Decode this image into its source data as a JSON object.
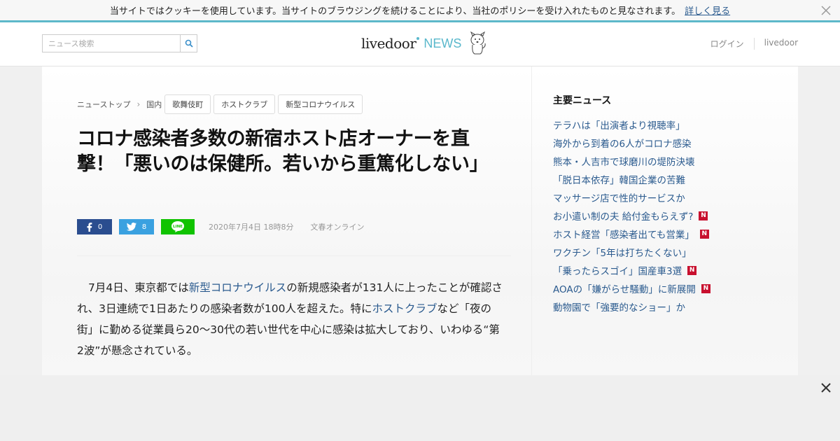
{
  "cookie": {
    "message": "当サイトではクッキーを使用しています。当サイトのブラウジングを続けることにより、当社のポリシーを受け入れたものと見なされます。",
    "more_link": "詳しく見る"
  },
  "header": {
    "search_placeholder": "ニュース検索",
    "logo_livedoor": "livedoor",
    "logo_news": "NEWS",
    "links": [
      "ログイン",
      "livedoor"
    ]
  },
  "breadcrumb": [
    "ニューストップ",
    "国内"
  ],
  "tags": [
    "歌舞伎町",
    "ホストクラブ",
    "新型コロナウイルス"
  ],
  "article": {
    "title": "コロナ感染者多数の新宿ホスト店オーナーを直撃！「悪いのは保健所。若いから重篤化しない」",
    "share": {
      "facebook_count": "0",
      "twitter_count": "8"
    },
    "date": "2020年7月4日 18時8分",
    "source": "文春オンライン",
    "body": {
      "p1": "7月4日、東京都では",
      "link1": "新型コロナウイルス",
      "p2": "の新規感染者が131人に上ったことが確認され、3日連続で1日あたりの感染者数が100人を超えた。特に",
      "link2": "ホストクラブ",
      "p3": "など「夜の街」に勤める従業員ら20～30代の若い世代を中心に感染は拡大しており、いわゆる“第2波”が懸念されている。"
    }
  },
  "sidebar": {
    "heading": "主要ニュース",
    "items": [
      {
        "label": "テラハは「出演者より視聴率」",
        "badge": ""
      },
      {
        "label": "海外から到着の6人がコロナ感染",
        "badge": ""
      },
      {
        "label": "熊本・人吉市で球磨川の堤防決壊",
        "badge": ""
      },
      {
        "label": "「脱日本依存」韓国企業の苦難",
        "badge": ""
      },
      {
        "label": "マッサージ店で性的サービスか",
        "badge": ""
      },
      {
        "label": "お小遣い制の夫 給付金もらえず?",
        "badge": "N"
      },
      {
        "label": "ホスト経営「感染者出ても営業」",
        "badge": "N"
      },
      {
        "label": "ワクチン「5年は打ちたくない」",
        "badge": ""
      },
      {
        "label": "「乗ったらスゴイ」国産車3選",
        "badge": "N"
      },
      {
        "label": "AOAの「嫌がらせ騒動」に新展開",
        "badge": "N"
      },
      {
        "label": "動物園で「強要的なショー」か",
        "badge": ""
      }
    ]
  },
  "colors": {
    "link": "#2a5a8e",
    "accent_line": "#5db8c9",
    "facebook": "#2a4d8f",
    "twitter": "#3aa1e0",
    "line": "#10c300",
    "badge": "#c8102e"
  }
}
